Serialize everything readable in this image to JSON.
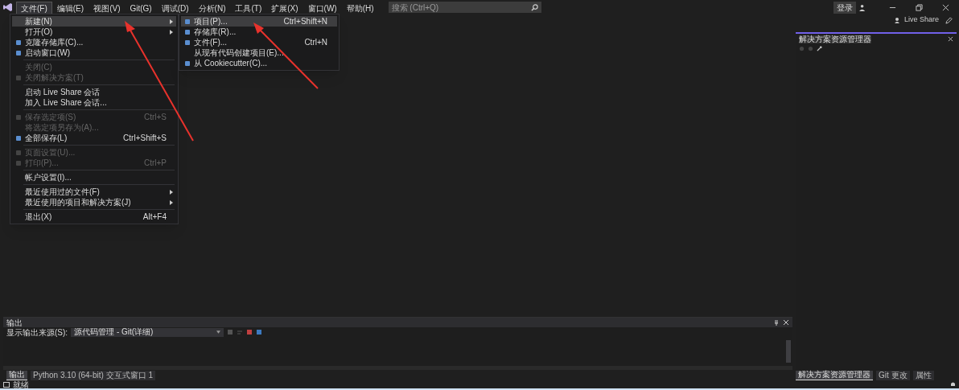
{
  "menu_bar": [
    {
      "label": "文件(F)",
      "selected": true
    },
    {
      "label": "编辑(E)",
      "selected": false
    },
    {
      "label": "视图(V)",
      "selected": false
    },
    {
      "label": "Git(G)",
      "selected": false
    },
    {
      "label": "调试(D)",
      "selected": false
    },
    {
      "label": "分析(N)",
      "selected": false
    },
    {
      "label": "工具(T)",
      "selected": false
    },
    {
      "label": "扩展(X)",
      "selected": false
    },
    {
      "label": "窗口(W)",
      "selected": false
    },
    {
      "label": "帮助(H)",
      "selected": false
    }
  ],
  "search": {
    "placeholder": "搜索 (Ctrl+Q)"
  },
  "account": {
    "label": "登录"
  },
  "live_share": {
    "label": "Live Share"
  },
  "file_menu": [
    {
      "kind": "item",
      "label": "新建(N)",
      "submenu": true,
      "disabled": false,
      "selected": true,
      "has_icon": false
    },
    {
      "kind": "item",
      "label": "打开(O)",
      "submenu": true,
      "disabled": false,
      "selected": false,
      "has_icon": false
    },
    {
      "kind": "item",
      "label": "克隆存储库(C)...",
      "submenu": false,
      "disabled": false,
      "selected": false,
      "has_icon": true
    },
    {
      "kind": "item",
      "label": "启动窗口(W)",
      "submenu": false,
      "disabled": false,
      "selected": false,
      "has_icon": true
    },
    {
      "kind": "separator"
    },
    {
      "kind": "item",
      "label": "关闭(C)",
      "submenu": false,
      "disabled": true,
      "selected": false,
      "has_icon": false
    },
    {
      "kind": "item",
      "label": "关闭解决方案(T)",
      "submenu": false,
      "disabled": true,
      "selected": false,
      "has_icon": true
    },
    {
      "kind": "separator"
    },
    {
      "kind": "item",
      "label": "启动 Live Share 会话",
      "submenu": false,
      "disabled": false,
      "selected": false,
      "has_icon": false
    },
    {
      "kind": "item",
      "label": "加入 Live Share 会话...",
      "submenu": false,
      "disabled": false,
      "selected": false,
      "has_icon": false
    },
    {
      "kind": "separator"
    },
    {
      "kind": "item",
      "label": "保存选定项(S)",
      "shortcut": "Ctrl+S",
      "submenu": false,
      "disabled": true,
      "selected": false,
      "has_icon": true
    },
    {
      "kind": "item",
      "label": "将选定项另存为(A)...",
      "submenu": false,
      "disabled": true,
      "selected": false,
      "has_icon": false
    },
    {
      "kind": "item",
      "label": "全部保存(L)",
      "shortcut": "Ctrl+Shift+S",
      "submenu": false,
      "disabled": false,
      "selected": false,
      "has_icon": true
    },
    {
      "kind": "separator"
    },
    {
      "kind": "item",
      "label": "页面设置(U)...",
      "submenu": false,
      "disabled": true,
      "selected": false,
      "has_icon": true
    },
    {
      "kind": "item",
      "label": "打印(P)...",
      "shortcut": "Ctrl+P",
      "submenu": false,
      "disabled": true,
      "selected": false,
      "has_icon": true
    },
    {
      "kind": "separator"
    },
    {
      "kind": "item",
      "label": "帐户设置(I)...",
      "submenu": false,
      "disabled": false,
      "selected": false,
      "has_icon": false
    },
    {
      "kind": "separator"
    },
    {
      "kind": "item",
      "label": "最近使用过的文件(F)",
      "submenu": true,
      "disabled": false,
      "selected": false,
      "has_icon": false
    },
    {
      "kind": "item",
      "label": "最近使用的项目和解决方案(J)",
      "submenu": true,
      "disabled": false,
      "selected": false,
      "has_icon": false
    },
    {
      "kind": "separator"
    },
    {
      "kind": "item",
      "label": "退出(X)",
      "shortcut": "Alt+F4",
      "submenu": false,
      "disabled": false,
      "selected": false,
      "has_icon": false
    }
  ],
  "new_submenu": [
    {
      "label": "项目(P)...",
      "shortcut": "Ctrl+Shift+N",
      "selected": true,
      "has_icon": true
    },
    {
      "label": "存储库(R)...",
      "selected": false,
      "has_icon": true
    },
    {
      "label": "文件(F)...",
      "shortcut": "Ctrl+N",
      "selected": false,
      "has_icon": true
    },
    {
      "label": "从现有代码创建项目(E)...",
      "selected": false,
      "has_icon": false
    },
    {
      "label": "从 Cookiecutter(C)...",
      "selected": false,
      "has_icon": true
    }
  ],
  "solution_explorer": {
    "title": "解决方案资源管理器"
  },
  "output_panel": {
    "title": "输出",
    "source_label": "显示输出来源(S):",
    "source_value": "源代码管理 - Git(详细)",
    "tabs": [
      {
        "label": "输出",
        "selected": true
      },
      {
        "label": "Python 3.10 (64-bit) 交互式窗口 1",
        "selected": false
      }
    ]
  },
  "right_tabs": [
    {
      "label": "解决方案资源管理器",
      "selected": true
    },
    {
      "label": "Git 更改",
      "selected": false
    },
    {
      "label": "属性",
      "selected": false
    }
  ],
  "status_bar": {
    "text": "就绪"
  }
}
